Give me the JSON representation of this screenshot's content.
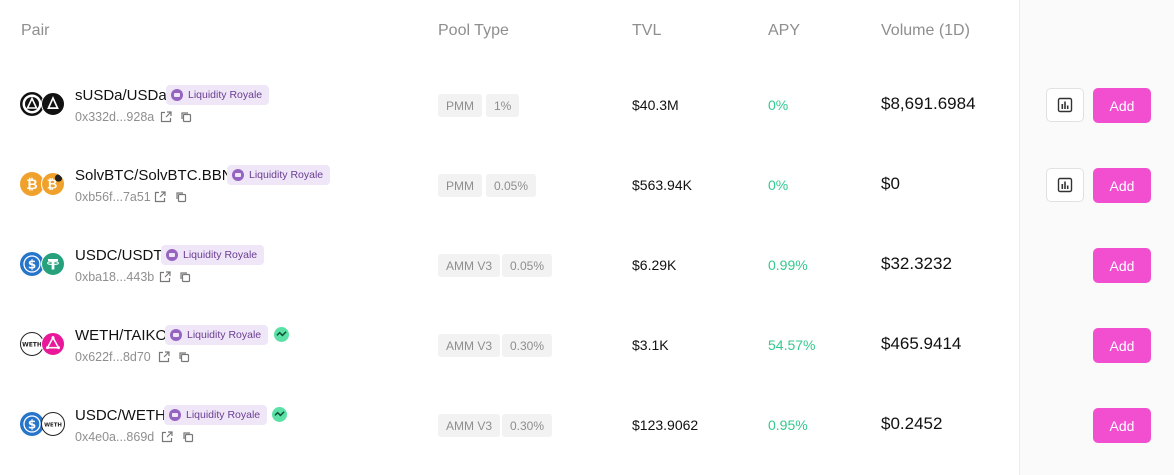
{
  "header": {
    "pair": "Pair",
    "pool_type": "Pool Type",
    "tvl": "TVL",
    "apy": "APY",
    "volume": "Volume (1D)"
  },
  "icons": {
    "external_link": "external-link-icon",
    "copy": "copy-icon",
    "chart": "bar-chart-icon",
    "tag": "liquidity-royale-icon",
    "badge": "activity-badge-icon"
  },
  "colors": {
    "add_button": "#f24fd0",
    "apy_green": "#34c98e",
    "tag_bg": "#efe6f7",
    "tag_text": "#6b3d93",
    "usdc_blue": "#2775ca",
    "usdt_green": "#26a17b",
    "taiko_pink": "#e81899",
    "btc_orange": "#f0a12c"
  },
  "rows": [
    {
      "pair": "sUSDa/USDa",
      "tag": "Liquidity Royale",
      "address": "0x332d...928a",
      "pool_type": "PMM",
      "fee": "1%",
      "tvl": "$40.3M",
      "apy": "0%",
      "volume": "$8,691.6984",
      "add": "Add"
    },
    {
      "pair": "SolvBTC/SolvBTC.BBN",
      "tag": "Liquidity Royale",
      "address": "0xb56f...7a51",
      "pool_type": "PMM",
      "fee": "0.05%",
      "tvl": "$563.94K",
      "apy": "0%",
      "volume": "$0",
      "add": "Add"
    },
    {
      "pair": "USDC/USDT",
      "tag": "Liquidity Royale",
      "address": "0xba18...443b",
      "pool_type": "AMM V3",
      "fee": "0.05%",
      "tvl": "$6.29K",
      "apy": "0.99%",
      "volume": "$32.3232",
      "add": "Add"
    },
    {
      "pair": "WETH/TAIKO",
      "tag": "Liquidity Royale",
      "address": "0x622f...8d70",
      "pool_type": "AMM V3",
      "fee": "0.30%",
      "tvl": "$3.1K",
      "apy": "54.57%",
      "volume": "$465.9414",
      "add": "Add"
    },
    {
      "pair": "USDC/WETH",
      "tag": "Liquidity Royale",
      "address": "0x4e0a...869d",
      "pool_type": "AMM V3",
      "fee": "0.30%",
      "tvl": "$123.9062",
      "apy": "0.95%",
      "volume": "$0.2452",
      "add": "Add"
    }
  ]
}
